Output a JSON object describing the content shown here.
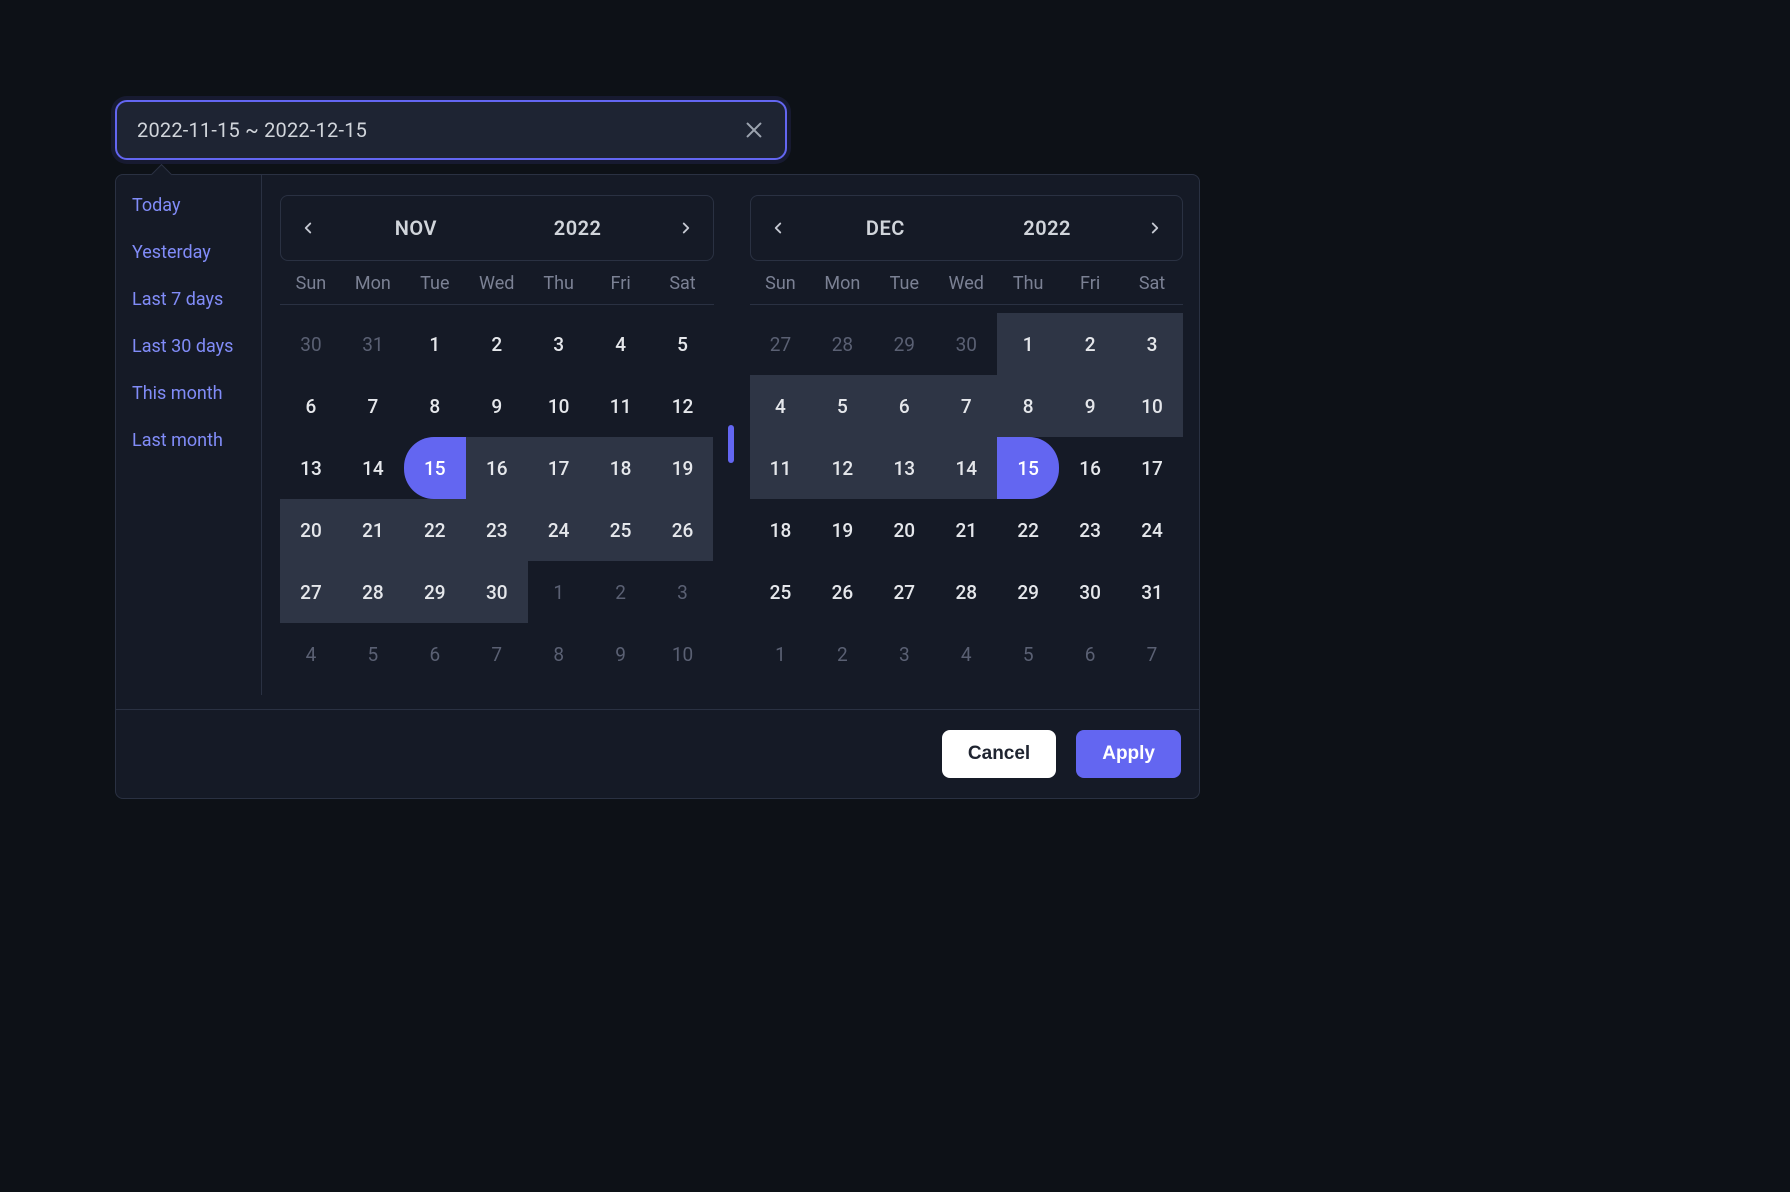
{
  "input": {
    "value": "2022-11-15 ~ 2022-12-15"
  },
  "presets": [
    "Today",
    "Yesterday",
    "Last 7 days",
    "Last 30 days",
    "This month",
    "Last month"
  ],
  "dow": [
    "Sun",
    "Mon",
    "Tue",
    "Wed",
    "Thu",
    "Fri",
    "Sat"
  ],
  "left": {
    "month": "NOV",
    "year": "2022",
    "cells": [
      {
        "n": 30,
        "out": true
      },
      {
        "n": 31,
        "out": true
      },
      {
        "n": 1
      },
      {
        "n": 2
      },
      {
        "n": 3
      },
      {
        "n": 4
      },
      {
        "n": 5
      },
      {
        "n": 6
      },
      {
        "n": 7
      },
      {
        "n": 8
      },
      {
        "n": 9
      },
      {
        "n": 10
      },
      {
        "n": 11
      },
      {
        "n": 12
      },
      {
        "n": 13
      },
      {
        "n": 14
      },
      {
        "n": 15,
        "selStart": true
      },
      {
        "n": 16,
        "inRange": true
      },
      {
        "n": 17,
        "inRange": true
      },
      {
        "n": 18,
        "inRange": true
      },
      {
        "n": 19,
        "inRange": true
      },
      {
        "n": 20,
        "inRange": true
      },
      {
        "n": 21,
        "inRange": true
      },
      {
        "n": 22,
        "inRange": true
      },
      {
        "n": 23,
        "inRange": true
      },
      {
        "n": 24,
        "inRange": true
      },
      {
        "n": 25,
        "inRange": true
      },
      {
        "n": 26,
        "inRange": true
      },
      {
        "n": 27,
        "inRange": true
      },
      {
        "n": 28,
        "inRange": true
      },
      {
        "n": 29,
        "inRange": true
      },
      {
        "n": 30,
        "inRange": true
      },
      {
        "n": 1,
        "out": true
      },
      {
        "n": 2,
        "out": true
      },
      {
        "n": 3,
        "out": true
      },
      {
        "n": 4,
        "out": true
      },
      {
        "n": 5,
        "out": true
      },
      {
        "n": 6,
        "out": true
      },
      {
        "n": 7,
        "out": true
      },
      {
        "n": 8,
        "out": true
      },
      {
        "n": 9,
        "out": true
      },
      {
        "n": 10,
        "out": true
      }
    ]
  },
  "right": {
    "month": "DEC",
    "year": "2022",
    "cells": [
      {
        "n": 27,
        "out": true
      },
      {
        "n": 28,
        "out": true
      },
      {
        "n": 29,
        "out": true
      },
      {
        "n": 30,
        "out": true
      },
      {
        "n": 1,
        "inRange": true
      },
      {
        "n": 2,
        "inRange": true
      },
      {
        "n": 3,
        "inRange": true
      },
      {
        "n": 4,
        "inRange": true
      },
      {
        "n": 5,
        "inRange": true
      },
      {
        "n": 6,
        "inRange": true
      },
      {
        "n": 7,
        "inRange": true
      },
      {
        "n": 8,
        "inRange": true
      },
      {
        "n": 9,
        "inRange": true
      },
      {
        "n": 10,
        "inRange": true
      },
      {
        "n": 11,
        "inRange": true
      },
      {
        "n": 12,
        "inRange": true
      },
      {
        "n": 13,
        "inRange": true
      },
      {
        "n": 14,
        "inRange": true
      },
      {
        "n": 15,
        "selEnd": true
      },
      {
        "n": 16
      },
      {
        "n": 17
      },
      {
        "n": 18
      },
      {
        "n": 19
      },
      {
        "n": 20
      },
      {
        "n": 21
      },
      {
        "n": 22
      },
      {
        "n": 23
      },
      {
        "n": 24
      },
      {
        "n": 25
      },
      {
        "n": 26
      },
      {
        "n": 27
      },
      {
        "n": 28
      },
      {
        "n": 29
      },
      {
        "n": 30
      },
      {
        "n": 31
      },
      {
        "n": 1,
        "out": true
      },
      {
        "n": 2,
        "out": true
      },
      {
        "n": 3,
        "out": true
      },
      {
        "n": 4,
        "out": true
      },
      {
        "n": 5,
        "out": true
      },
      {
        "n": 6,
        "out": true
      },
      {
        "n": 7,
        "out": true
      }
    ]
  },
  "actions": {
    "cancel": "Cancel",
    "apply": "Apply"
  }
}
